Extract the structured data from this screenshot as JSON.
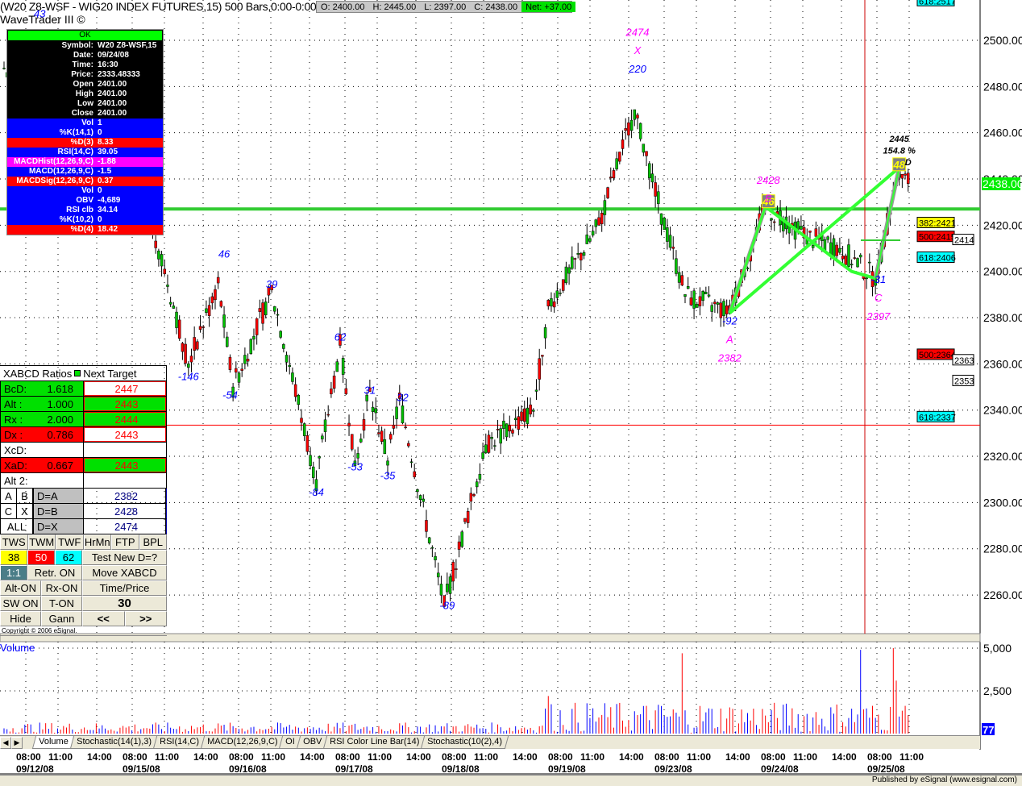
{
  "header": {
    "title": "(W20 Z8-WSF - WIG20 INDEX FUTURES,15) 500 Bars,0:00-0:00",
    "subtitle": "WaveTrader III ©",
    "ohlc": {
      "open": "O: 2400.00",
      "high": "H: 2445.00",
      "low": "L: 2397.00",
      "close": "C: 2438.00",
      "net": "Net: +37.00"
    }
  },
  "data_window": {
    "status": "OK",
    "rows": [
      {
        "k": "Symbol:",
        "v": "W20 Z8-WSF,15",
        "c": ""
      },
      {
        "k": "Date:",
        "v": "09/24/08",
        "c": ""
      },
      {
        "k": "Time:",
        "v": "16:30",
        "c": ""
      },
      {
        "k": "Price:",
        "v": "2333.48333",
        "c": ""
      },
      {
        "k": "Open",
        "v": "2401.00",
        "c": ""
      },
      {
        "k": "High",
        "v": "2401.00",
        "c": ""
      },
      {
        "k": "Low",
        "v": "2401.00",
        "c": ""
      },
      {
        "k": "Close",
        "v": "2401.00",
        "c": ""
      },
      {
        "k": "Vol",
        "v": "1",
        "c": "bl"
      },
      {
        "k": "%K(14,1)",
        "v": "0",
        "c": "bl"
      },
      {
        "k": "%D(3)",
        "v": "8.33",
        "c": "rd"
      },
      {
        "k": "RSI(14,C)",
        "v": "39.05",
        "c": "bl"
      },
      {
        "k": "MACDHist(12,26,9,C)",
        "v": "-1.88",
        "c": "mg"
      },
      {
        "k": "MACD(12,26,9,C)",
        "v": "-1.5",
        "c": "bl"
      },
      {
        "k": "MACDSig(12,26,9,C)",
        "v": "0.37",
        "c": "rd"
      },
      {
        "k": "Vol",
        "v": "0",
        "c": "bl"
      },
      {
        "k": "OBV",
        "v": "-4,689",
        "c": "bl"
      },
      {
        "k": "RSI clb",
        "v": "34.14",
        "c": "bl"
      },
      {
        "k": "%K(10,2)",
        "v": "0",
        "c": "bl"
      },
      {
        "k": "%D(4)",
        "v": "18.42",
        "c": "rd"
      }
    ]
  },
  "xabcd": {
    "header": "XABCD Ratios",
    "header2": "Next Target",
    "ratios": [
      {
        "k": "BcD:",
        "v": "1.618",
        "t": "2447",
        "kc": "#00e000",
        "tc": "#fff"
      },
      {
        "k": "Alt  :",
        "v": "1.000",
        "t": "2443",
        "kc": "#00e000",
        "tc": "#00e000"
      },
      {
        "k": "Rx   :",
        "v": "2.000",
        "t": "2444",
        "kc": "#00e000",
        "tc": "#00e000"
      },
      {
        "k": "Dx   :",
        "v": "0.786",
        "t": "2443",
        "kc": "#ff0000",
        "tc": "#fff"
      },
      {
        "k": "XcD:",
        "v": "",
        "t": "",
        "kc": "#fff",
        "tc": "#fff"
      },
      {
        "k": "XaD:",
        "v": "0.667",
        "t": "2443",
        "kc": "#ff0000",
        "tc": "#00e000"
      },
      {
        "k": "Alt 2:",
        "v": "",
        "t": "",
        "kc": "#fff",
        "tc": "#fff"
      }
    ],
    "pts": [
      {
        "a": "A",
        "b": "B",
        "d": "D=A",
        "v": "2382"
      },
      {
        "a": "C",
        "b": "X",
        "d": "D=B",
        "v": "2428"
      },
      {
        "a": "ALL",
        "b": "",
        "d": "D=X",
        "v": "2474"
      }
    ],
    "buttons": {
      "tws": "TWS",
      "twm": "TWM",
      "twf": "TWF",
      "hrmn": "HrMn",
      "ftp": "FTP",
      "bpl": "BPL",
      "f38": "38",
      "f50": "50",
      "f62": "62",
      "test": "Test New D=?",
      "one": "1:1",
      "retr": "Retr. ON",
      "move": "Move XABCD",
      "alt": "Alt-ON",
      "rx": "Rx-ON",
      "tp": "Time/Price",
      "sw": "SW ON",
      "t": "T-ON",
      "num": "30",
      "hide": "Hide",
      "gann": "Gann",
      "prev": "<<",
      "next": ">>"
    },
    "copyright": "Copyright © 2006 eSignal."
  },
  "tabs": [
    "Volume",
    "Stochastic(14(1),3)",
    "RSI(14,C)",
    "MACD(12,26,9,C)",
    "OI",
    "OBV",
    "RSI Color Line Bar(14)",
    "Stochastic(10(2),4)"
  ],
  "volume_panel": {
    "title": "Volume",
    "axis": [
      "5,000",
      "2,500"
    ],
    "last": "77"
  },
  "footer": "Published by eSignal (www.esignal.com)",
  "price_axis": [
    "2500.00",
    "2480.00",
    "2460.00",
    "2440.00",
    "2420.00",
    "2400.00",
    "2380.00",
    "2360.00",
    "2340.00",
    "2320.00",
    "2300.00",
    "2280.00",
    "2260.00"
  ],
  "last_price": "2438.00",
  "fib_tags": [
    {
      "t": "618:2517",
      "c": "#00ffff",
      "p": 2517
    },
    {
      "t": "382:2421",
      "c": "#ffff00",
      "p": 2421
    },
    {
      "t": "500:2415",
      "c": "#ff0000",
      "p": 2415
    },
    {
      "t": "618:2406",
      "c": "#00ffff",
      "p": 2406
    },
    {
      "t": "500:2364",
      "c": "#ff0000",
      "p": 2364
    },
    {
      "t": "618:2337",
      "c": "#00ffff",
      "p": 2337
    }
  ],
  "side_tags": [
    {
      "t": "2414",
      "p": 2414
    },
    {
      "t": "2363",
      "p": 2363
    },
    {
      "t": "2353",
      "p": 2353
    }
  ],
  "time_axis": [
    {
      "t": "08:00",
      "d": "09/12/08"
    },
    {
      "t": "11:00"
    },
    {
      "t": "14:00"
    },
    {
      "t": "08:00",
      "d": "09/15/08"
    },
    {
      "t": "11:00"
    },
    {
      "t": "14:00"
    },
    {
      "t": "08:00",
      "d": "09/16/08"
    },
    {
      "t": "11:00"
    },
    {
      "t": "14:00"
    },
    {
      "t": "08:00",
      "d": "09/17/08"
    },
    {
      "t": "11:00"
    },
    {
      "t": "14:00"
    },
    {
      "t": "08:00",
      "d": "09/18/08"
    },
    {
      "t": "11:00"
    },
    {
      "t": "14:00"
    },
    {
      "t": "08:00",
      "d": "09/19/08"
    },
    {
      "t": "11:00"
    },
    {
      "t": "14:00"
    },
    {
      "t": "08:00",
      "d": "09/23/08"
    },
    {
      "t": "11:00"
    },
    {
      "t": "14:00"
    },
    {
      "t": "08:00",
      "d": "09/24/08"
    },
    {
      "t": "11:00"
    },
    {
      "t": "14:00"
    },
    {
      "t": "08:00",
      "d": "09/25/08"
    },
    {
      "t": "11:00"
    }
  ],
  "chart_data": {
    "type": "candlestick",
    "ylim": [
      2245,
      2517
    ],
    "bars_per_day": 36,
    "pivots": [
      [
        0,
        2488
      ],
      [
        50,
        2420
      ],
      [
        62,
        2360
      ],
      [
        72,
        2395
      ],
      [
        77,
        2350
      ],
      [
        90,
        2392
      ],
      [
        105,
        2310
      ],
      [
        113,
        2368
      ],
      [
        118,
        2318
      ],
      [
        123,
        2348
      ],
      [
        129,
        2318
      ],
      [
        133,
        2345
      ],
      [
        148,
        2255
      ],
      [
        162,
        2325
      ],
      [
        178,
        2340
      ],
      [
        183,
        2385
      ],
      [
        200,
        2420
      ],
      [
        212,
        2470
      ],
      [
        216,
        2450
      ],
      [
        221,
        2425
      ],
      [
        229,
        2390
      ],
      [
        244,
        2382
      ],
      [
        256,
        2428
      ],
      [
        270,
        2415
      ],
      [
        281,
        2410
      ],
      [
        293,
        2397
      ],
      [
        301,
        2445
      ],
      [
        304,
        2438
      ]
    ],
    "swing_labels": [
      {
        "t": "43",
        "bar": 12,
        "p": 2510,
        "c": "blue"
      },
      {
        "t": "46",
        "bar": 74,
        "p": 2406,
        "c": "blue"
      },
      {
        "t": "-146",
        "bar": 62,
        "p": 2353,
        "c": "blue"
      },
      {
        "t": "39",
        "bar": 90,
        "p": 2393,
        "c": "blue"
      },
      {
        "t": "-54",
        "bar": 76,
        "p": 2345,
        "c": "blue"
      },
      {
        "t": "62",
        "bar": 113,
        "p": 2370,
        "c": "blue"
      },
      {
        "t": "-84",
        "bar": 105,
        "p": 2303,
        "c": "blue"
      },
      {
        "t": "31",
        "bar": 123,
        "p": 2347,
        "c": "blue"
      },
      {
        "t": "-53",
        "bar": 118,
        "p": 2314,
        "c": "blue"
      },
      {
        "t": "32",
        "bar": 134,
        "p": 2344,
        "c": "blue"
      },
      {
        "t": "-35",
        "bar": 129,
        "p": 2310,
        "c": "blue"
      },
      {
        "t": "-89",
        "bar": 149,
        "p": 2254,
        "c": "blue"
      },
      {
        "t": "220",
        "bar": 213,
        "p": 2486,
        "c": "blue"
      },
      {
        "t": "-92",
        "bar": 244,
        "p": 2377,
        "c": "blue"
      },
      {
        "t": "-31",
        "bar": 294,
        "p": 2395,
        "c": "blue"
      },
      {
        "t": "2474",
        "bar": 213,
        "p": 2502,
        "c": "magenta"
      },
      {
        "t": "X",
        "bar": 213,
        "p": 2494,
        "c": "magenta"
      },
      {
        "t": "2428",
        "bar": 257,
        "p": 2438,
        "c": "magenta"
      },
      {
        "t": "B",
        "bar": 257,
        "p": 2430,
        "c": "magenta"
      },
      {
        "t": "A",
        "bar": 244,
        "p": 2369,
        "c": "magenta"
      },
      {
        "t": "2382",
        "bar": 244,
        "p": 2361,
        "c": "magenta"
      },
      {
        "t": "C",
        "bar": 294,
        "p": 2387,
        "c": "magenta"
      },
      {
        "t": "2397",
        "bar": 294,
        "p": 2379,
        "c": "magenta"
      },
      {
        "t": "2445",
        "bar": 301,
        "p": 2456,
        "c": "black"
      },
      {
        "t": "154.8 %",
        "bar": 301,
        "p": 2451,
        "c": "black"
      },
      {
        "t": "D",
        "bar": 304,
        "p": 2446,
        "c": "black"
      }
    ],
    "boxes": [
      {
        "t": "46",
        "bar": 257,
        "p": 2430
      },
      {
        "t": "48",
        "bar": 301,
        "p": 2446
      }
    ],
    "hlines": [
      {
        "p": 2427,
        "c": "#33cc33"
      },
      {
        "p": 2333.5,
        "c": "#ff0000"
      }
    ],
    "volume_axis": [
      0,
      5000
    ]
  }
}
